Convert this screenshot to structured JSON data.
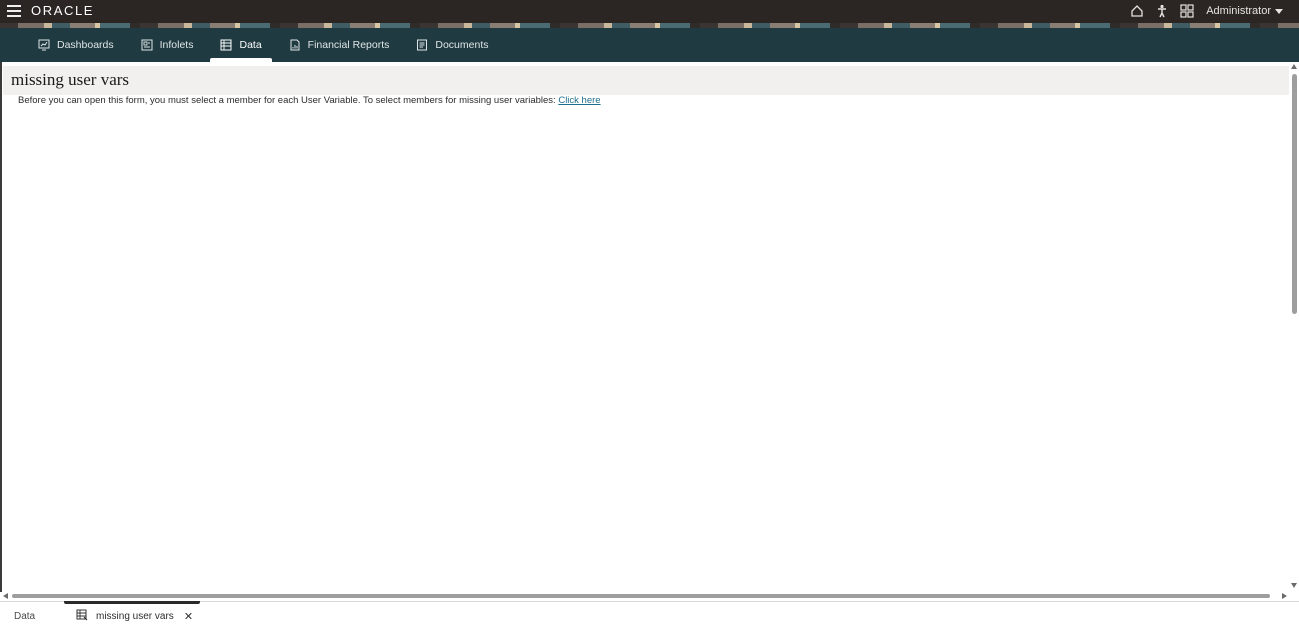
{
  "brand": {
    "logo_text": "ORACLE"
  },
  "user": {
    "name": "Administrator"
  },
  "nav": {
    "tabs": [
      {
        "label": "Dashboards",
        "icon": "dashboard-icon",
        "active": false
      },
      {
        "label": "Infolets",
        "icon": "infolets-icon",
        "active": false
      },
      {
        "label": "Data",
        "icon": "grid-icon",
        "active": true
      },
      {
        "label": "Financial Reports",
        "icon": "report-icon",
        "active": false
      },
      {
        "label": "Documents",
        "icon": "document-icon",
        "active": false
      }
    ]
  },
  "page": {
    "title": "missing user vars",
    "message": "Before you can open this form, you must select a member for each User Variable. To select members for missing user variables:",
    "link_label": "Click here"
  },
  "bottom_tabs": {
    "data_label": "Data",
    "form_label": "missing user vars",
    "close_glyph": "✕"
  },
  "colors": {
    "topbar": "#2b2624",
    "navbar": "#1f3a40",
    "link": "#1e6d8a",
    "header_bg": "#f1f0ef"
  }
}
